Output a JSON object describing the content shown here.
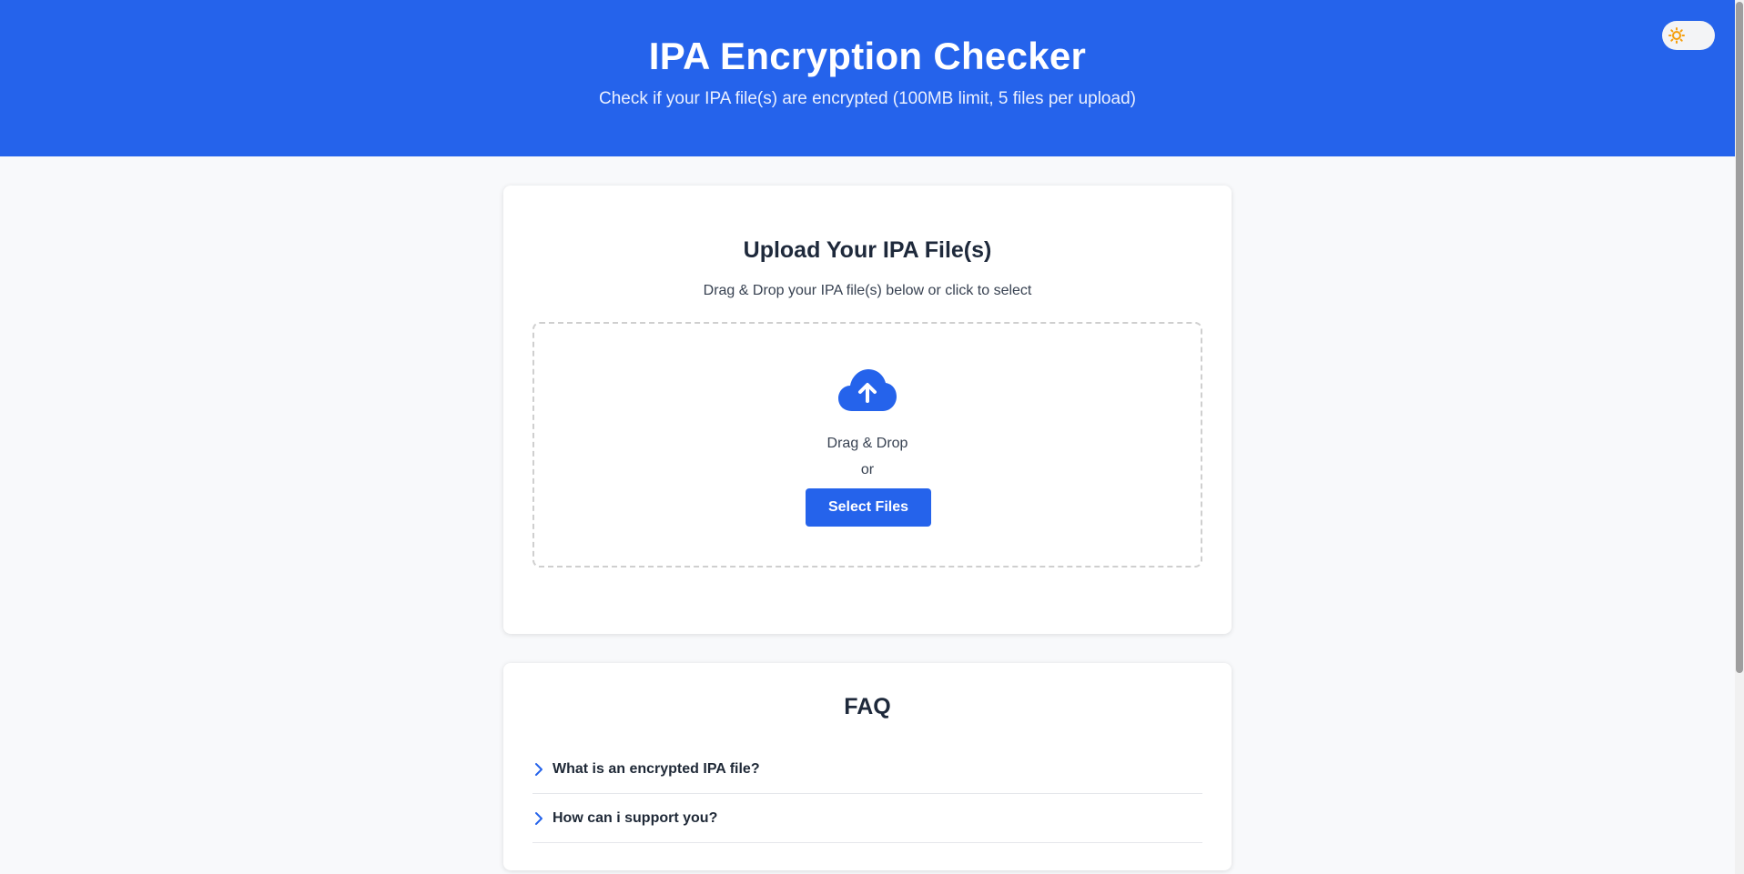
{
  "header": {
    "title": "IPA Encryption Checker",
    "subtitle": "Check if your IPA file(s) are encrypted (100MB limit, 5 files per upload)",
    "theme_toggle_icon": "sun-icon"
  },
  "upload": {
    "heading": "Upload Your IPA File(s)",
    "hint": "Drag & Drop your IPA file(s) below or click to select",
    "dropzone": {
      "icon": "cloud-upload-icon",
      "drag_text": "Drag & Drop",
      "or_text": "or",
      "button_label": "Select Files"
    }
  },
  "faq": {
    "heading": "FAQ",
    "items": [
      {
        "question": "What is an encrypted IPA file?",
        "icon": "chevron-right-icon"
      },
      {
        "question": "How can i support you?",
        "icon": "chevron-right-icon"
      }
    ]
  },
  "colors": {
    "accent": "#2563eb",
    "page_background": "#f8f9fb",
    "card_background": "#ffffff",
    "sun": "#f59e0b"
  }
}
